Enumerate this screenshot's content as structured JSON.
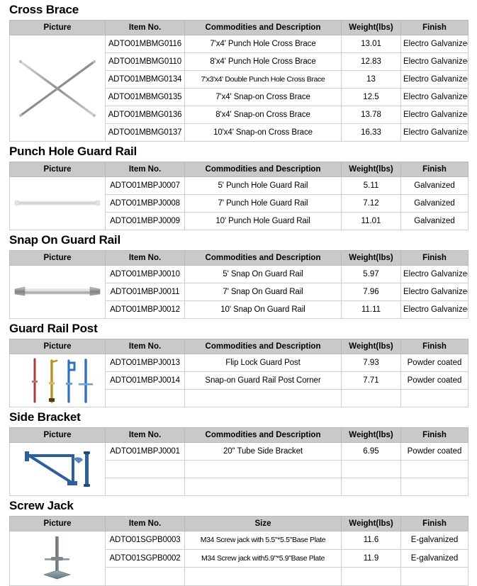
{
  "document": {
    "type": "product-specification-sheet",
    "columns_default": [
      "Picture",
      "Item No.",
      "Commodities and Description",
      "Weight(lbs)",
      "Finish"
    ],
    "colors": {
      "header_background": "#c9c9c9",
      "table_border": "#b9b9b9",
      "cell_border": "#cfcfcf",
      "page_background": "#ffffff",
      "text": "#000000"
    }
  },
  "sections": [
    {
      "title": "Cross Brace",
      "picture_icon": "cross-brace-icon",
      "columns": [
        "Picture",
        "Item No.",
        "Commodities and Description",
        "Weight(lbs)",
        "Finish"
      ],
      "rows": [
        {
          "item_no": "ADTO01MBMG0116",
          "description": "7'x4' Punch Hole Cross Brace",
          "weight": "13.01",
          "finish": "Electro Galvanized"
        },
        {
          "item_no": "ADTO01MBMG0110",
          "description": "8'x4' Punch Hole Cross Brace",
          "weight": "12.83",
          "finish": "Electro Galvanized"
        },
        {
          "item_no": "ADTO01MBMG0134",
          "description": "7'x3'x4' Double Punch Hole Cross Brace",
          "weight": "13",
          "finish": "Electro Galvanized"
        },
        {
          "item_no": "ADTO01MBMG0135",
          "description": "7'x4' Snap-on Cross Brace",
          "weight": "12.5",
          "finish": "Electro Galvanized"
        },
        {
          "item_no": "ADTO01MBMG0136",
          "description": "8'x4' Snap-on Cross Brace",
          "weight": "13.78",
          "finish": "Electro Galvanized"
        },
        {
          "item_no": "ADTO01MBMG0137",
          "description": "10'x4' Snap-on Cross Brace",
          "weight": "16.33",
          "finish": "Electro Galvanized"
        }
      ]
    },
    {
      "title": "Punch Hole Guard Rail",
      "picture_icon": "punch-hole-guard-rail-icon",
      "columns": [
        "Picture",
        "Item No.",
        "Commodities and Description",
        "Weight(lbs)",
        "Finish"
      ],
      "rows": [
        {
          "item_no": "ADTO01MBPJ0007",
          "description": "5' Punch Hole Guard Rail",
          "weight": "5.11",
          "finish": "Galvanized"
        },
        {
          "item_no": "ADTO01MBPJ0008",
          "description": "7' Punch Hole Guard Rail",
          "weight": "7.12",
          "finish": "Galvanized"
        },
        {
          "item_no": "ADTO01MBPJ0009",
          "description": "10' Punch Hole Guard Rail",
          "weight": "11.01",
          "finish": "Galvanized"
        }
      ]
    },
    {
      "title": "Snap On Guard Rail",
      "picture_icon": "snap-on-guard-rail-icon",
      "columns": [
        "Picture",
        "Item No.",
        "Commodities and Description",
        "Weight(lbs)",
        "Finish"
      ],
      "rows": [
        {
          "item_no": "ADTO01MBPJ0010",
          "description": "5' Snap On Guard Rail",
          "weight": "5.97",
          "finish": "Electro Galvanized"
        },
        {
          "item_no": "ADTO01MBPJ0011",
          "description": "7' Snap On Guard Rail",
          "weight": "7.96",
          "finish": "Electro Galvanized"
        },
        {
          "item_no": "ADTO01MBPJ0012",
          "description": "10' Snap On Guard Rail",
          "weight": "11.11",
          "finish": "Electro Galvanized"
        }
      ]
    },
    {
      "title": "Guard Rail Post",
      "picture_icon": "guard-rail-post-icon",
      "columns": [
        "Picture",
        "Item No.",
        "Commodities and Description",
        "Weight(lbs)",
        "Finish"
      ],
      "rows": [
        {
          "item_no": "ADTO01MBPJ0013",
          "description": "Flip Lock Guard Post",
          "weight": "7.93",
          "finish": "Powder coated"
        },
        {
          "item_no": "ADTO01MBPJ0014",
          "description": "Snap-on Guard Rail Post Corner",
          "weight": "7.71",
          "finish": "Powder coated"
        },
        {
          "item_no": "",
          "description": "",
          "weight": "",
          "finish": ""
        }
      ]
    },
    {
      "title": "Side Bracket",
      "picture_icon": "side-bracket-icon",
      "columns": [
        "Picture",
        "Item No.",
        "Commodities and Description",
        "Weight(lbs)",
        "Finish"
      ],
      "rows": [
        {
          "item_no": "ADTO01MBPJ0001",
          "description": "20\" Tube Side Bracket",
          "weight": "6.95",
          "finish": "Powder coated"
        },
        {
          "item_no": "",
          "description": "",
          "weight": "",
          "finish": ""
        },
        {
          "item_no": "",
          "description": "",
          "weight": "",
          "finish": ""
        }
      ]
    },
    {
      "title": "Screw Jack",
      "picture_icon": "screw-jack-icon",
      "columns": [
        "Picture",
        "Item No.",
        "Size",
        "Weight(lbs)",
        "Finish"
      ],
      "rows": [
        {
          "item_no": "ADTO01SGPB0003",
          "description": "M34 Screw jack with 5.5\"*5.5\"Base Plate",
          "weight": "11.6",
          "finish": "E-galvanized"
        },
        {
          "item_no": "ADTO01SGPB0002",
          "description": "M34 Screw jack with5.9\"*5.9\"Base Plate",
          "weight": "11.9",
          "finish": "E-galvanized"
        },
        {
          "item_no": "",
          "description": "",
          "weight": "",
          "finish": ""
        }
      ]
    }
  ]
}
